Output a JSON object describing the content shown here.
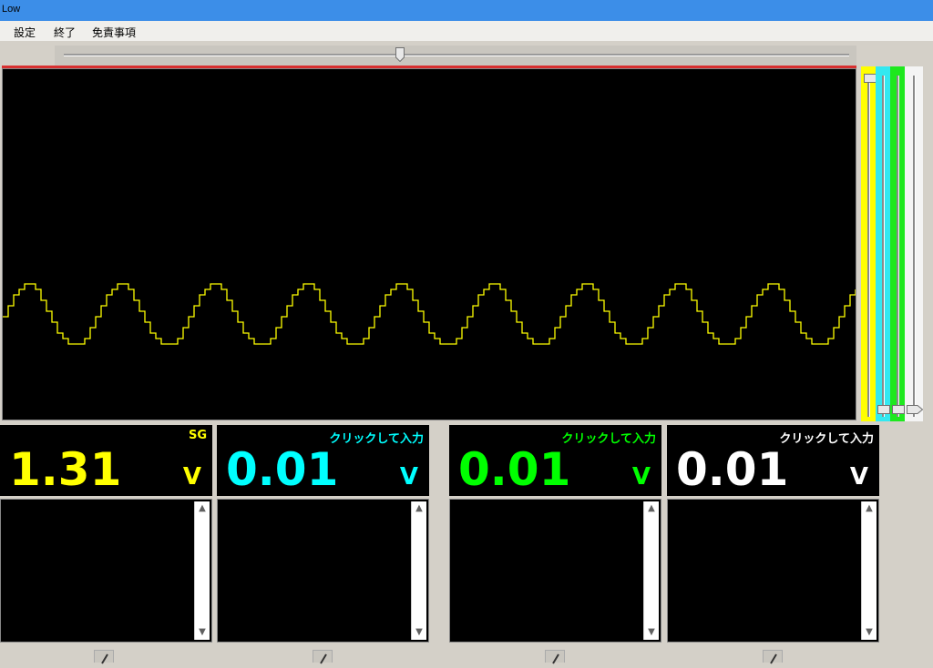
{
  "window": {
    "title": "Low"
  },
  "menu": {
    "items": [
      "設定",
      "終了",
      "免責事項"
    ]
  },
  "colors": {
    "ch1": "#ffff00",
    "ch2": "#00ffff",
    "ch3": "#00ff00",
    "ch4": "#ffffff"
  },
  "channels": [
    {
      "label": "SG",
      "value": "1.31",
      "unit": "V",
      "color": "#ffff00"
    },
    {
      "label": "クリックして入力",
      "value": "0.01",
      "unit": "V",
      "color": "#00ffff"
    },
    {
      "label": "クリックして入力",
      "value": "0.01",
      "unit": "V",
      "color": "#00ff00"
    },
    {
      "label": "クリックして入力",
      "value": "0.01",
      "unit": "V",
      "color": "#ffffff"
    }
  ],
  "icons": {
    "pencil": "pencil-icon",
    "scroll_up": "scroll-up-icon",
    "scroll_down": "scroll-down-icon"
  }
}
